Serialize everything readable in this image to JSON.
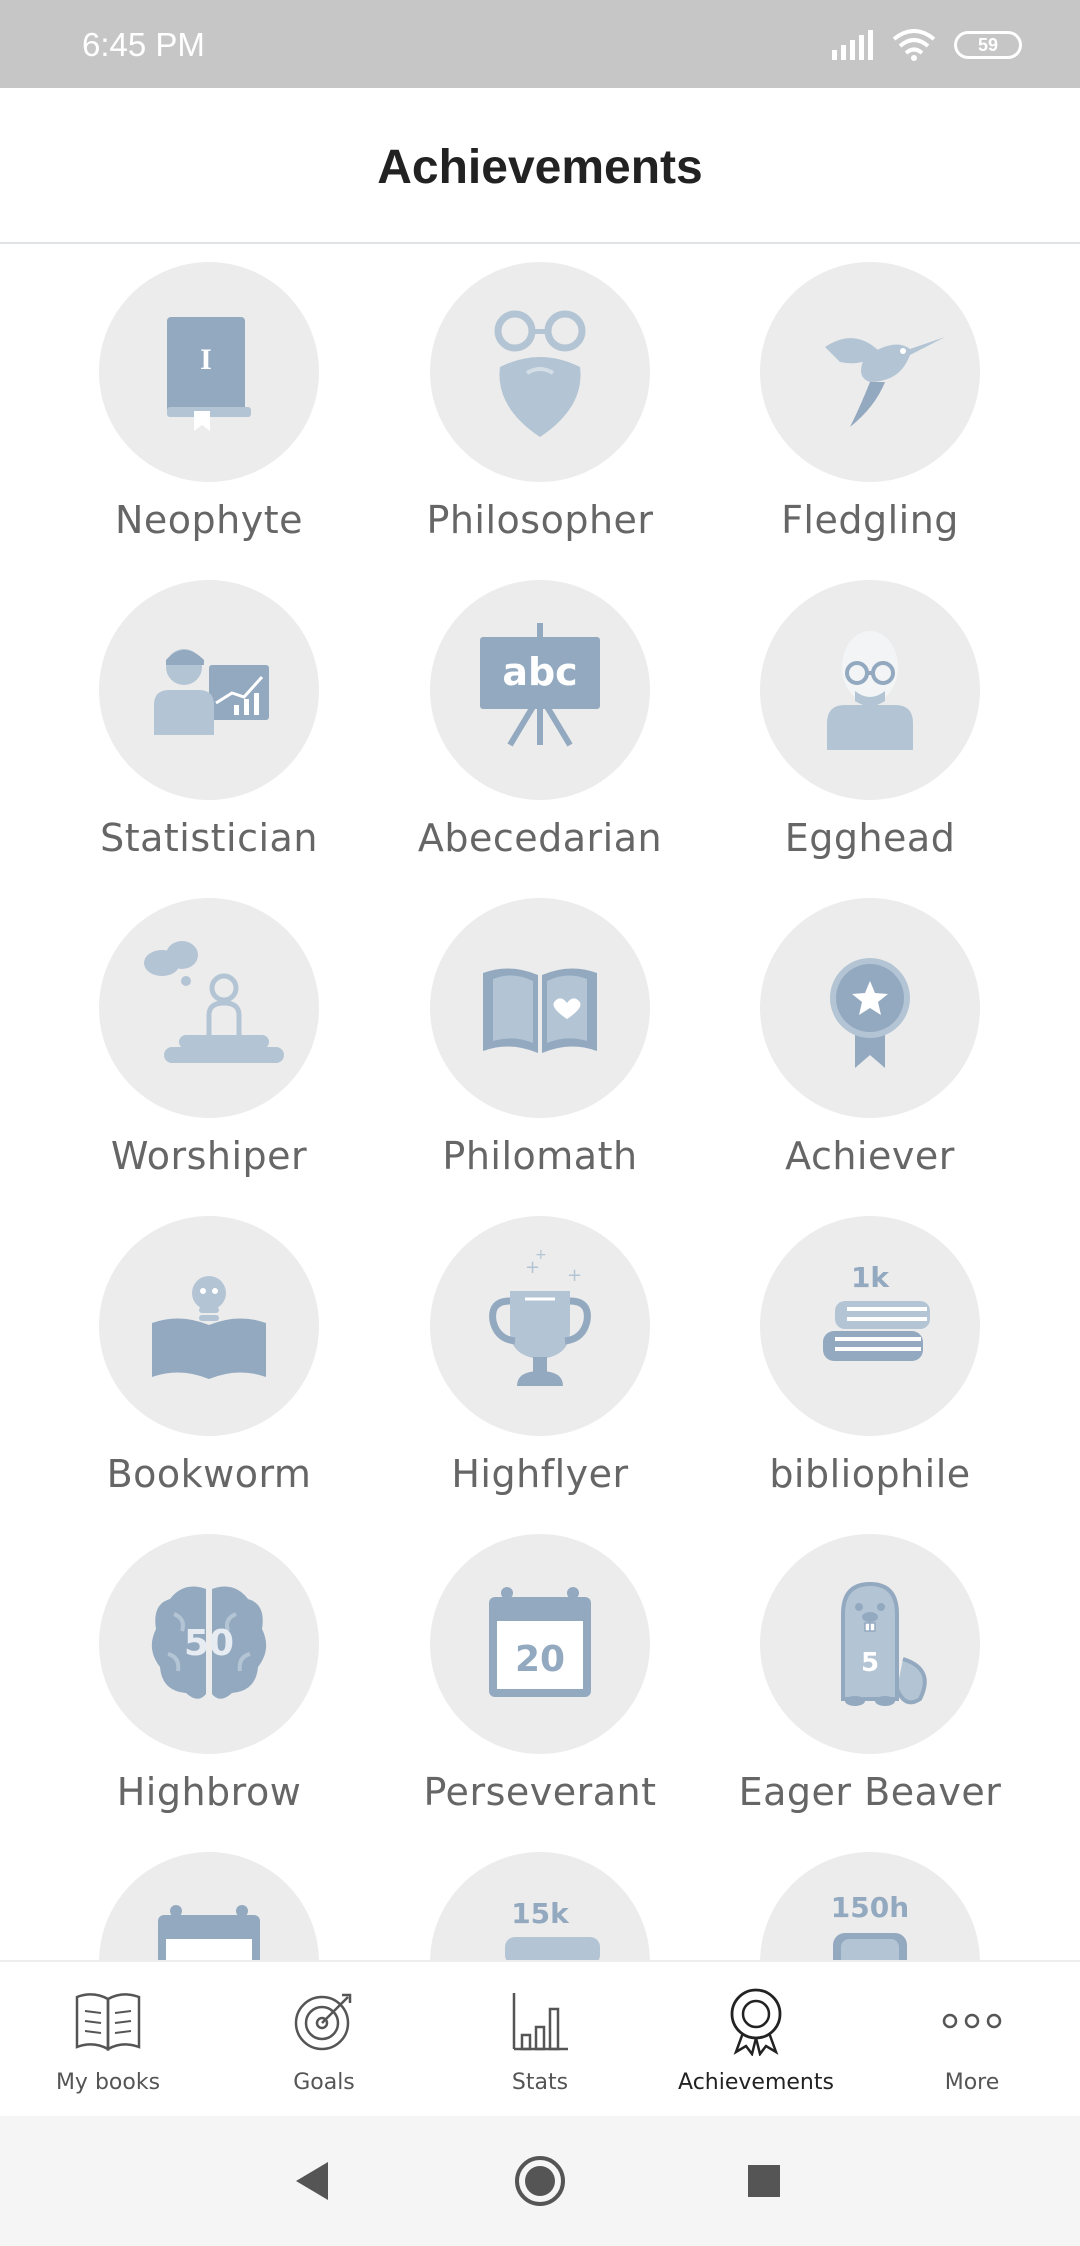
{
  "status_bar": {
    "time": "6:45 PM",
    "battery": "59"
  },
  "header": {
    "title": "Achievements"
  },
  "achievements": [
    {
      "label": "Neophyte",
      "icon": "book-icon"
    },
    {
      "label": "Philosopher",
      "icon": "philosopher-beard-icon"
    },
    {
      "label": "Fledgling",
      "icon": "hummingbird-icon"
    },
    {
      "label": "Statistician",
      "icon": "presenter-chart-icon"
    },
    {
      "label": "Abecedarian",
      "icon": "abc-easel-icon"
    },
    {
      "label": "Egghead",
      "icon": "egghead-icon"
    },
    {
      "label": "Worshiper",
      "icon": "meditating-figure-icon"
    },
    {
      "label": "Philomath",
      "icon": "open-book-heart-icon"
    },
    {
      "label": "Achiever",
      "icon": "rosette-star-icon"
    },
    {
      "label": "Bookworm",
      "icon": "bookworm-icon"
    },
    {
      "label": "Highflyer",
      "icon": "trophy-icon"
    },
    {
      "label": "bibliophile",
      "icon": "book-stack-icon",
      "badge_text": "1k"
    },
    {
      "label": "Highbrow",
      "icon": "brain-icon",
      "badge_text": "50"
    },
    {
      "label": "Perseverant",
      "icon": "calendar-icon",
      "badge_text": "20"
    },
    {
      "label": "Eager Beaver",
      "icon": "beaver-icon",
      "badge_text": "5"
    },
    {
      "label": "",
      "icon": "calendar-icon"
    },
    {
      "label": "",
      "icon": "book-stack-icon",
      "badge_text": "15k"
    },
    {
      "label": "",
      "icon": "clock-book-icon",
      "badge_text": "150h"
    }
  ],
  "nav": [
    {
      "label": "My books",
      "icon": "open-book-icon"
    },
    {
      "label": "Goals",
      "icon": "target-icon"
    },
    {
      "label": "Stats",
      "icon": "bar-chart-icon"
    },
    {
      "label": "Achievements",
      "icon": "medal-icon",
      "active": true
    },
    {
      "label": "More",
      "icon": "more-dots-icon"
    }
  ],
  "colors": {
    "badge_bg": "#ececec",
    "icon_fill": "#b3c4d4",
    "icon_dark": "#93a9c0",
    "label": "#666666"
  }
}
